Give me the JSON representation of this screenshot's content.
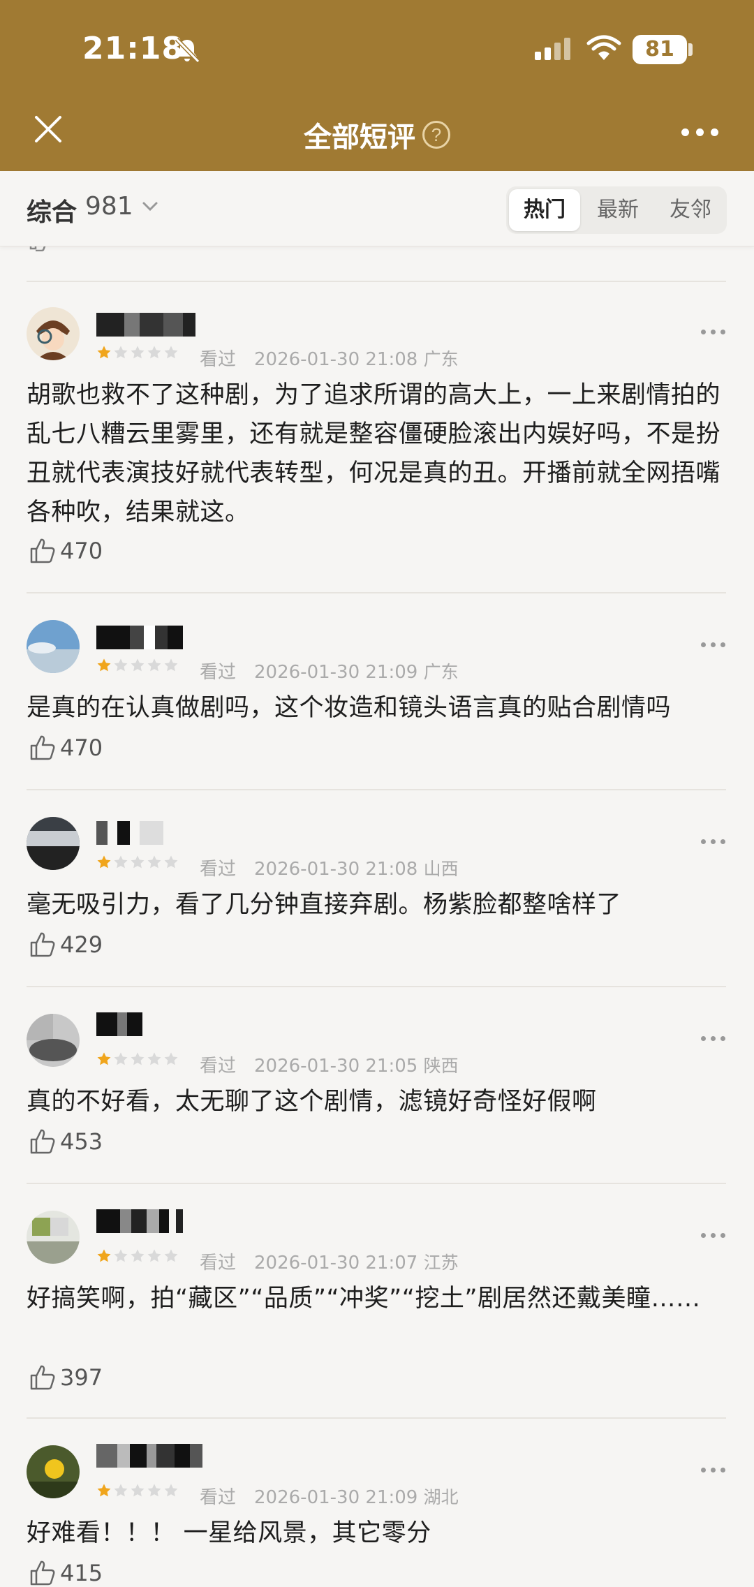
{
  "status_bar": {
    "time": "21:18",
    "battery": "81"
  },
  "nav": {
    "title": "全部短评",
    "help": "?"
  },
  "filter": {
    "sort_label": "综合",
    "sort_count": "981",
    "tabs": [
      {
        "label": "热门",
        "active": true
      },
      {
        "label": "最新",
        "active": false
      },
      {
        "label": "友邻",
        "active": false
      }
    ]
  },
  "comments": [
    {
      "rating": 1,
      "watched": "看过",
      "time": "2026-01-30 21:08",
      "location": "广东",
      "text": "胡歌也救不了这种剧，为了追求所谓的高大上，一上来剧情拍的乱七八糟云里雾里，还有就是整容僵硬脸滚出内娱好吗，不是扮丑就代表演技好就代表转型，何况是真的丑。开播前就全网捂嘴各种吹，结果就这。",
      "likes": "470"
    },
    {
      "rating": 1,
      "watched": "看过",
      "time": "2026-01-30 21:09",
      "location": "广东",
      "text": "是真的在认真做剧吗，这个妆造和镜头语言真的贴合剧情吗",
      "likes": "470"
    },
    {
      "rating": 1,
      "watched": "看过",
      "time": "2026-01-30 21:08",
      "location": "山西",
      "text": "毫无吸引力，看了几分钟直接弃剧。杨紫脸都整啥样了",
      "likes": "429"
    },
    {
      "rating": 1,
      "watched": "看过",
      "time": "2026-01-30 21:05",
      "location": "陕西",
      "text": "真的不好看，太无聊了这个剧情，滤镜好奇怪好假啊",
      "likes": "453"
    },
    {
      "rating": 1,
      "watched": "看过",
      "time": "2026-01-30 21:07",
      "location": "江苏",
      "text": "好搞笑啊，拍“藏区”“品质”“冲奖”“挖土”剧居然还戴美瞳……",
      "likes": "397"
    },
    {
      "rating": 1,
      "watched": "看过",
      "time": "2026-01-30 21:09",
      "location": "湖北",
      "text": "好难看！！！ 一星给风景，其它零分",
      "likes": "415"
    }
  ],
  "colors": {
    "header": "#a07a33",
    "star_on": "#f0a51c",
    "star_off": "#d9d9d9"
  }
}
